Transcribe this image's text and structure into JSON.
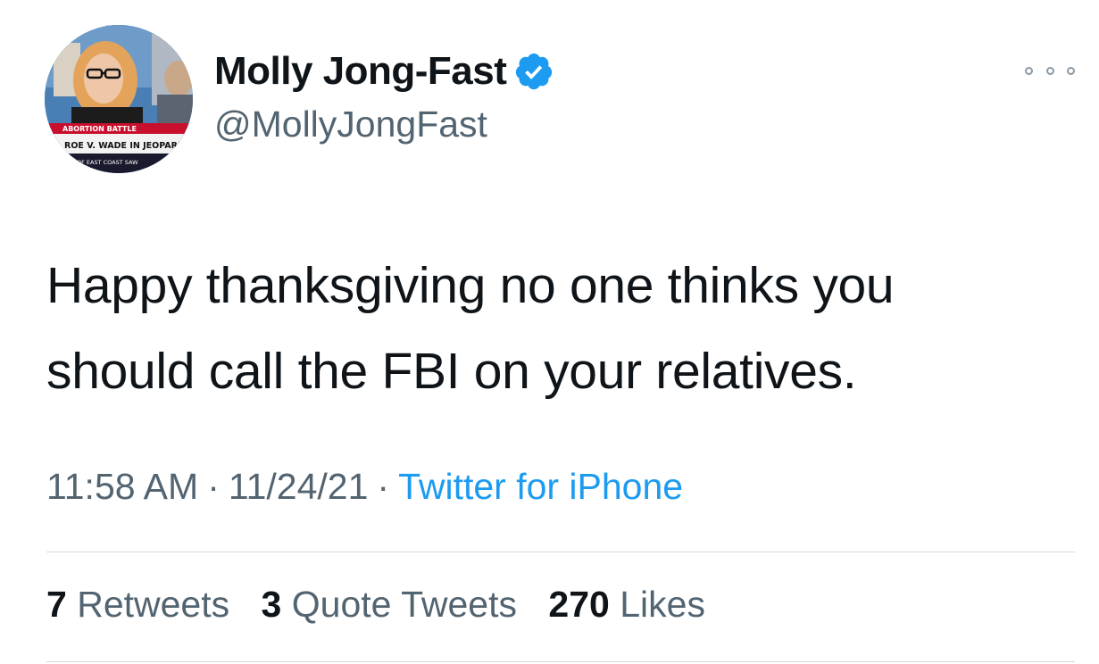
{
  "colors": {
    "text_primary": "#0f1419",
    "text_secondary": "#536471",
    "link": "#1d9bf0",
    "verified_badge": "#1d9bf0",
    "divider": "#cfd9de"
  },
  "author": {
    "display_name": "Molly Jong-Fast",
    "handle": "@MollyJongFast",
    "verified": true,
    "avatar_icon": "profile-photo",
    "avatar_chyron": {
      "label": "ABORTION BATTLE",
      "headline": "ROE V. WADE IN JEOPARDY AS TE",
      "ticker": "OF EAST COAST SAW"
    }
  },
  "more_icon": "ellipsis-icon",
  "tweet": {
    "text_line_1": "Happy thanksgiving no one thinks you",
    "text_line_2": "should call the FBI on your relatives."
  },
  "meta": {
    "time": "11:58 AM",
    "date": "11/24/21",
    "separator": "·",
    "source": "Twitter for iPhone"
  },
  "stats": {
    "retweets_count": "7",
    "retweets_label": "Retweets",
    "quotes_count": "3",
    "quotes_label": "Quote Tweets",
    "likes_count": "270",
    "likes_label": "Likes"
  }
}
